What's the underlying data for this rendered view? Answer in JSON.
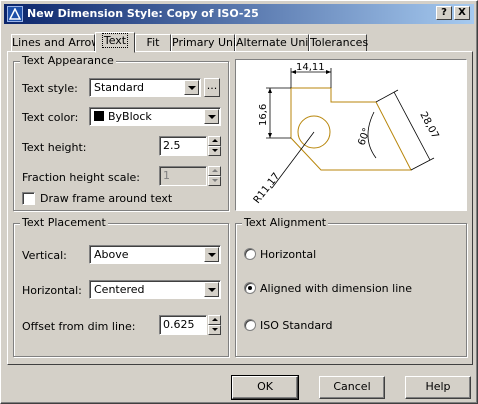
{
  "window": {
    "title": "New Dimension Style: Copy of ISO-25",
    "help_btn": "?",
    "close_btn": "X"
  },
  "tabs": [
    {
      "label": "Lines and Arrows"
    },
    {
      "label": "Text",
      "active": true
    },
    {
      "label": "Fit"
    },
    {
      "label": "Primary Units"
    },
    {
      "label": "Alternate Units"
    },
    {
      "label": "Tolerances"
    }
  ],
  "text_appearance": {
    "group_label": "Text Appearance",
    "style_label": "Text style:",
    "style_value": "Standard",
    "style_browse": "...",
    "color_label": "Text color:",
    "color_value": "ByBlock",
    "color_swatch": "#000000",
    "height_label": "Text height:",
    "height_value": "2.5",
    "fraction_label": "Fraction height scale:",
    "fraction_value": "1",
    "frame_label": "Draw frame around text",
    "frame_checked": false
  },
  "preview": {
    "dim_top": "14,11",
    "dim_left": "16,6",
    "dim_right": "28,07",
    "dim_angle": "60°",
    "dim_radius": "R11,17",
    "geometry_color": "#b8860b"
  },
  "text_placement": {
    "group_label": "Text Placement",
    "vertical_label": "Vertical:",
    "vertical_value": "Above",
    "horizontal_label": "Horizontal:",
    "horizontal_value": "Centered",
    "offset_label": "Offset from dim line:",
    "offset_value": "0.625"
  },
  "text_alignment": {
    "group_label": "Text Alignment",
    "options": [
      {
        "label": "Horizontal",
        "checked": false
      },
      {
        "label": "Aligned with dimension line",
        "checked": true
      },
      {
        "label": "ISO Standard",
        "checked": false
      }
    ]
  },
  "buttons": {
    "ok": "OK",
    "cancel": "Cancel",
    "help": "Help"
  }
}
